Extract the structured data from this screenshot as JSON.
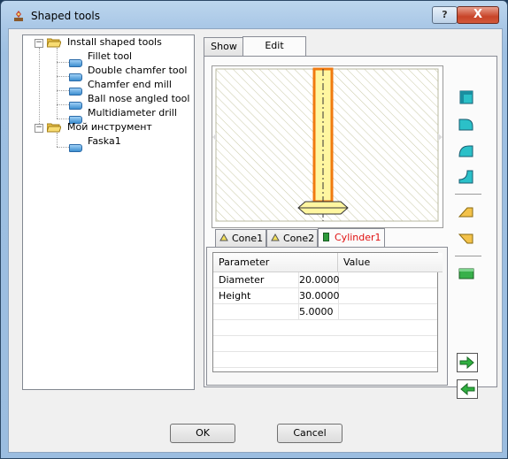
{
  "window": {
    "title": "Shaped tools",
    "help_label": "?",
    "close_label": "X"
  },
  "tree": {
    "items": [
      {
        "label": "Install shaped tools",
        "type": "folder",
        "level": 0
      },
      {
        "label": "Fillet tool",
        "type": "tool",
        "level": 1
      },
      {
        "label": "Double chamfer tool",
        "type": "tool",
        "level": 1
      },
      {
        "label": "Chamfer end mill",
        "type": "tool",
        "level": 1
      },
      {
        "label": "Ball nose angled tool",
        "type": "tool",
        "level": 1
      },
      {
        "label": "Multidiameter drill",
        "type": "tool",
        "level": 1
      },
      {
        "label": "Мой инструмент",
        "type": "folder",
        "level": 0
      },
      {
        "label": "Faska1",
        "type": "tool",
        "level": 1
      }
    ]
  },
  "tabs": [
    {
      "label": "Show",
      "active": false
    },
    {
      "label": "Edit",
      "active": true
    }
  ],
  "segment_tabs": [
    {
      "label": "Cone1",
      "active": false,
      "icon": "cone-icon"
    },
    {
      "label": "Cone2",
      "active": false,
      "icon": "cone-icon"
    },
    {
      "label": "Cylinder1",
      "active": true,
      "icon": "cylinder-icon"
    }
  ],
  "grid": {
    "headers": [
      "Parameter",
      "Value"
    ],
    "rows": [
      {
        "param": "Diameter",
        "value": "20.0000"
      },
      {
        "param": "Height",
        "value": "30.0000"
      },
      {
        "param": "",
        "value": "5.0000"
      }
    ]
  },
  "buttons": {
    "ok": "OK",
    "cancel": "Cancel"
  },
  "colors": {
    "accent_red": "#e01010",
    "tool_outline": "#f07a10",
    "tool_fill": "#fff6a0"
  }
}
